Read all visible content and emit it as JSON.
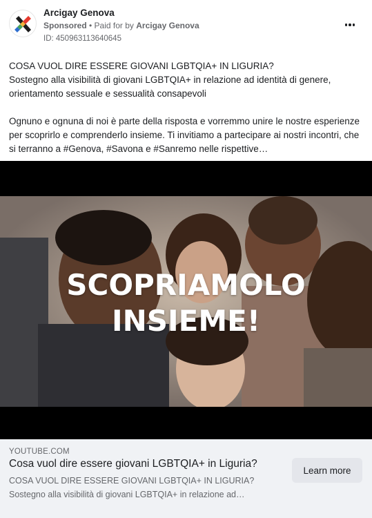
{
  "post": {
    "page_name": "Arcigay Genova",
    "sponsored_label": "Sponsored",
    "sponsored_dot": " • ",
    "paid_for_prefix": "Paid for by ",
    "paid_for_by": "Arcigay Genova",
    "ad_id": "ID: 450963113640645",
    "more_icon": "more-horizontal-icon",
    "body": [
      "COSA VUOL DIRE ESSERE GIOVANI LGBTQIA+ IN LIGURIA?",
      "Sostegno alla visibilità di giovani LGBTQIA+ in relazione ad identità di genere, orientamento sessuale e sessualità consapevoli",
      "",
      "Ognuno e ognuna di noi è parte della risposta e vorremmo unire le nostre esperienze per scoprirlo e comprenderlo insieme. Ti invitiamo a partecipare ai nostri incontri, che si terranno a #Genova, #Savona e #Sanremo nelle rispettive…"
    ]
  },
  "media": {
    "overlay_line1": "SCOPRIAMOLO",
    "overlay_line2": "INSIEME!"
  },
  "link": {
    "domain": "YOUTUBE.COM",
    "title": "Cosa vuol dire essere giovani LGBTQIA+ in Liguria?",
    "description_line1": "COSA VUOL DIRE ESSERE GIOVANI LGBTQIA+ IN LIGURIA?",
    "description_line2": "Sostegno alla visibilità di giovani LGBTQIA+ in relazione ad…",
    "cta_label": "Learn more"
  },
  "colors": {
    "text_primary": "#1c1e21",
    "text_secondary": "#65676b",
    "link_bg": "#f0f2f5",
    "button_bg": "#e4e6eb",
    "media_bg": "#000000",
    "logo_colors": [
      "#1c1c1c",
      "#e63a2e",
      "#f2b33a",
      "#8a5fb6",
      "#2f6fd0",
      "#46a35b"
    ]
  }
}
